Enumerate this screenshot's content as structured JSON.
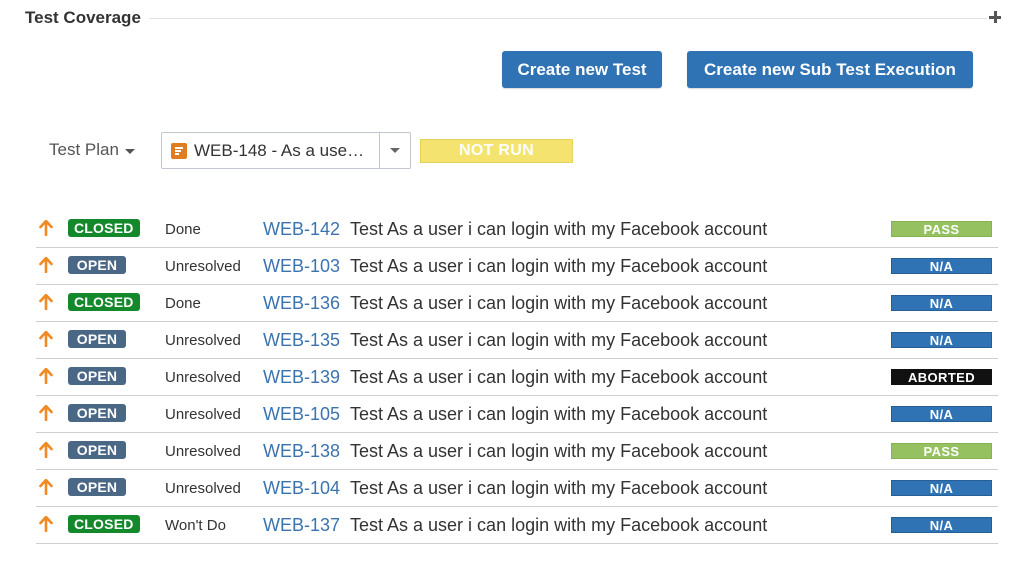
{
  "section": {
    "title": "Test Coverage"
  },
  "actions": {
    "create_test_label": "Create new Test",
    "create_sub_execution_label": "Create new Sub Test Execution"
  },
  "test_plan": {
    "label": "Test Plan",
    "selected": "WEB-148 - As a use…",
    "overall_status": "NOT RUN"
  },
  "colors": {
    "button_blue": "#2f73b4",
    "closed_green": "#14892c",
    "open_slate": "#4a6785",
    "pass_green": "#95c160",
    "na_blue": "#2f73b4",
    "aborted_black": "#111111",
    "not_run_yellow": "#f4e36f",
    "priority_orange": "#f08a24",
    "link_blue": "#3b73af"
  },
  "tests": [
    {
      "status": "CLOSED",
      "resolution": "Done",
      "key": "WEB-142",
      "summary": "Test As a user i can login with my Facebook account",
      "execution": "PASS"
    },
    {
      "status": "OPEN",
      "resolution": "Unresolved",
      "key": "WEB-103",
      "summary": "Test As a user i can login with my Facebook account",
      "execution": "N/A"
    },
    {
      "status": "CLOSED",
      "resolution": "Done",
      "key": "WEB-136",
      "summary": "Test As a user i can login with my Facebook account",
      "execution": "N/A"
    },
    {
      "status": "OPEN",
      "resolution": "Unresolved",
      "key": "WEB-135",
      "summary": "Test As a user i can login with my Facebook account",
      "execution": "N/A"
    },
    {
      "status": "OPEN",
      "resolution": "Unresolved",
      "key": "WEB-139",
      "summary": "Test As a user i can login with my Facebook account",
      "execution": "ABORTED"
    },
    {
      "status": "OPEN",
      "resolution": "Unresolved",
      "key": "WEB-105",
      "summary": "Test As a user i can login with my Facebook account",
      "execution": "N/A"
    },
    {
      "status": "OPEN",
      "resolution": "Unresolved",
      "key": "WEB-138",
      "summary": "Test As a user i can login with my Facebook account",
      "execution": "PASS"
    },
    {
      "status": "OPEN",
      "resolution": "Unresolved",
      "key": "WEB-104",
      "summary": "Test As a user i can login with my Facebook account",
      "execution": "N/A"
    },
    {
      "status": "CLOSED",
      "resolution": "Won't Do",
      "key": "WEB-137",
      "summary": "Test As a user i can login with my Facebook account",
      "execution": "N/A"
    }
  ]
}
